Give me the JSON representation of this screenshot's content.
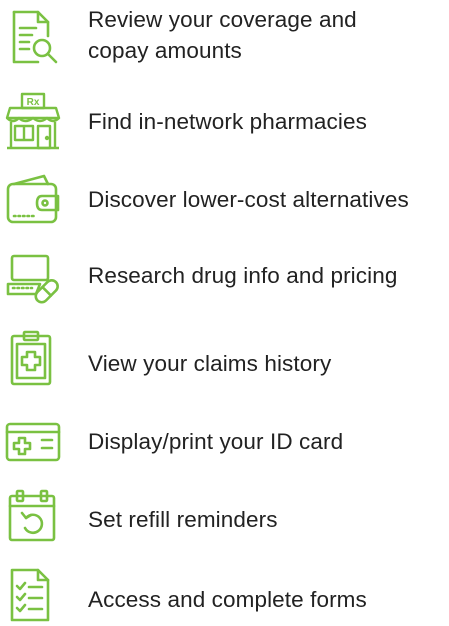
{
  "accent_color": "#7ac142",
  "items": [
    {
      "icon": "document-search-icon",
      "label": "Review your coverage and copay amounts"
    },
    {
      "icon": "pharmacy-storefront-icon",
      "label": "Find in-network pharmacies",
      "sign": "Rx"
    },
    {
      "icon": "wallet-icon",
      "label": "Discover lower-cost alternatives"
    },
    {
      "icon": "laptop-pill-icon",
      "label": "Research drug info and pricing"
    },
    {
      "icon": "clipboard-medical-icon",
      "label": "View your claims history"
    },
    {
      "icon": "id-card-icon",
      "label": "Display/print your ID card"
    },
    {
      "icon": "calendar-refill-icon",
      "label": "Set refill reminders"
    },
    {
      "icon": "checklist-form-icon",
      "label": "Access and complete forms"
    }
  ]
}
